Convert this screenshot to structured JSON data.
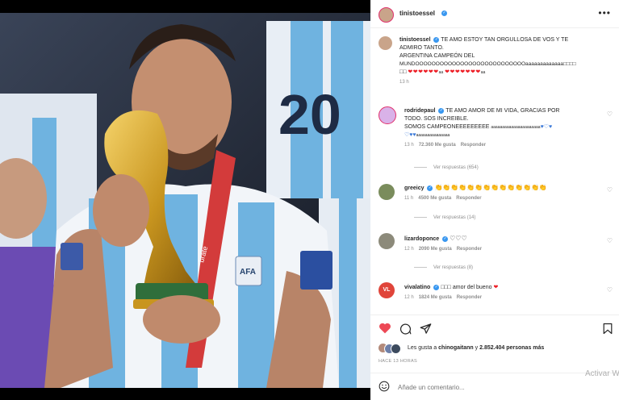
{
  "post": {
    "author": "tinistoessel",
    "more_icon": "more-horizontal-icon"
  },
  "caption": {
    "user": "tinistoessel",
    "line1": "TE AMO ESTOY TAN ORGULLOSA DE VOS Y TE",
    "line2": "ADMIRO TANTO.",
    "line3": "ARGENTINA CAMPEÓN DEL",
    "line4": "MUNDOOOOOOOOOOOOOOOOOOOOOOOOOOOaaaaaaaaaaaaa□□□□",
    "line5_prefix": "□□",
    "line5_hearts": "❤❤❤❤❤❤",
    "line5_mid": "aa",
    "line5_hearts2": "❤❤❤❤❤❤❤",
    "line5_suffix": "aa",
    "time": "13 h"
  },
  "comments": [
    {
      "user": "rodridepaul",
      "line1": "TE AMO AMOR DE MI VIDA, GRACIAS POR",
      "line2": "TODO. SOS INCREIBLE.",
      "line3": "SOMOS CAMPEONEEEEEEEEE",
      "line3_tail": "aaaaaaaaaaaaaaaaaaaaaa",
      "line3_hearts": "♥♡♥",
      "line4_hearts": "♡♥♥",
      "line4_tail": "aaaaaaaaaaaaaaa",
      "time": "13 h",
      "likes": "72.360 Me gusta",
      "reply": "Responder",
      "view_replies": "Ver respuestas (654)"
    },
    {
      "user": "greeicy",
      "text": "👏👏👏👏👏👏👏👏👏👏👏👏👏👏",
      "time": "11 h",
      "likes": "4500 Me gusta",
      "reply": "Responder",
      "view_replies": "Ver respuestas (14)"
    },
    {
      "user": "lizardoponce",
      "text": "♡♡♡",
      "time": "12 h",
      "likes": "2090 Me gusta",
      "reply": "Responder",
      "view_replies": "Ver respuestas (8)"
    },
    {
      "user": "vivalatino",
      "text_prefix": "□□□",
      "text": "amor del bueno",
      "text_heart": "❤",
      "time": "12 h",
      "likes": "1824 Me gusta",
      "reply": "Responder"
    }
  ],
  "likes_line": {
    "prefix": "Les gusta a",
    "user": "chinogaitann",
    "suffix": "y",
    "count": "2.852.404 personas más"
  },
  "date": "HACE 13 HORAS",
  "comment_input": {
    "placeholder": "Añade un comentario..."
  },
  "watermark": "Activar Wi",
  "photo_text": {
    "afa": "AFA",
    "brate": "brate"
  },
  "colors": {
    "like_red": "#ed4956",
    "verified_blue": "#3897f0",
    "shirt_blue": "#6fb3e0"
  }
}
